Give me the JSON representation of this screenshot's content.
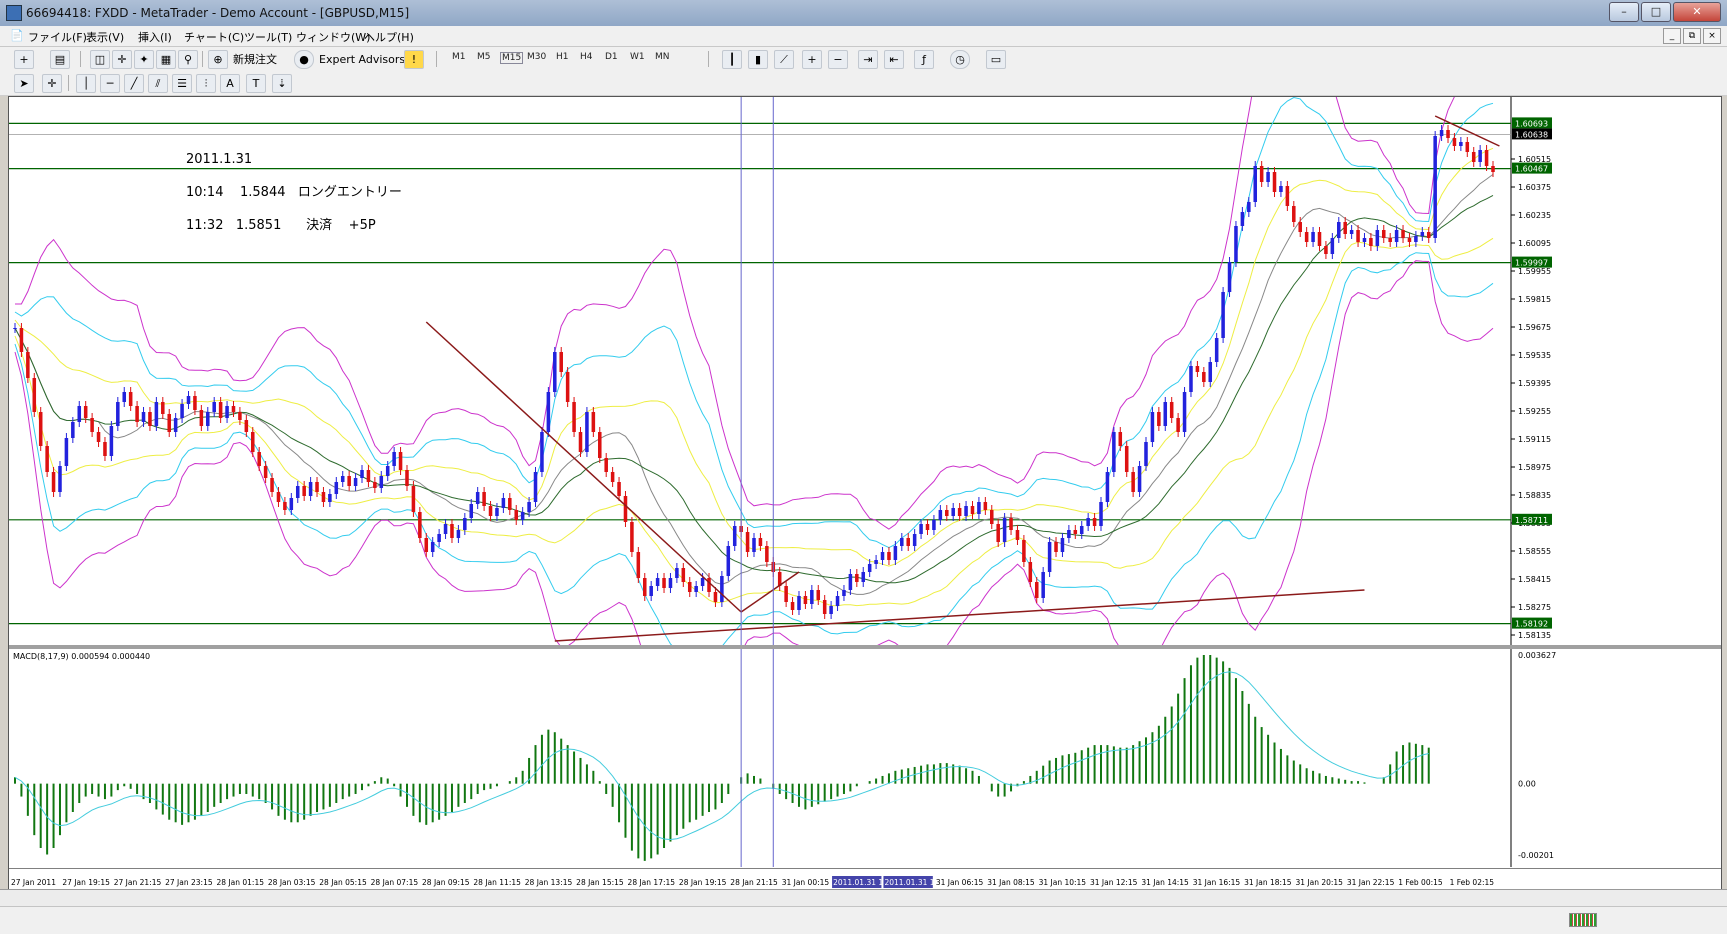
{
  "window": {
    "title": "66694418: FXDD - MetaTrader - Demo Account - [GBPUSD,M15]",
    "min_label": "–",
    "max_label": "□",
    "close_label": "✕"
  },
  "menu": [
    "ファイル(F)",
    "表示(V)",
    "挿入(I)",
    "チャート(C)",
    "ツール(T)",
    "ウィンドウ(W)",
    "ヘルプ(H)"
  ],
  "mdi_controls": [
    "_",
    "⧉",
    "×"
  ],
  "toolbar": {
    "new_order": "新規注文",
    "expert_advisors": "Expert Advisors",
    "timeframes": [
      "M1",
      "M5",
      "M15",
      "M30",
      "H1",
      "H4",
      "D1",
      "W1",
      "MN"
    ],
    "draw_text_tool": "A"
  },
  "chart": {
    "symbol": "GBPUSD",
    "period": "M15",
    "annotation": [
      "2011.1.31",
      "10:14    1.5844   ロングエントリー",
      "11:32   1.5851      決済    +5P"
    ],
    "price_axis": [
      "1.60515",
      "1.60375",
      "1.60235",
      "1.60095",
      "1.59955",
      "1.59815",
      "1.59675",
      "1.59535",
      "1.59395",
      "1.59255",
      "1.59115",
      "1.58975",
      "1.58835",
      "1.58695",
      "1.58555",
      "1.58415",
      "1.58275",
      "1.58135"
    ],
    "hlines": [
      {
        "price": 1.60693,
        "label": "1.60693"
      },
      {
        "price": 1.60467,
        "label": "1.60467"
      },
      {
        "price": 1.59997,
        "label": "1.59997"
      },
      {
        "price": 1.58711,
        "label": "1.58711"
      },
      {
        "price": 1.58192,
        "label": "1.58192"
      }
    ],
    "current_price": {
      "price": 1.60638,
      "label": "1.60638"
    },
    "price_range": [
      1.58105,
      1.60805
    ],
    "time_axis": [
      "27 Jan 2011",
      "27 Jan 19:15",
      "27 Jan 21:15",
      "27 Jan 23:15",
      "28 Jan 01:15",
      "28 Jan 03:15",
      "28 Jan 05:15",
      "28 Jan 07:15",
      "28 Jan 09:15",
      "28 Jan 11:15",
      "28 Jan 13:15",
      "28 Jan 15:15",
      "28 Jan 17:15",
      "28 Jan 19:15",
      "28 Jan 21:15",
      "31 Jan 00:15",
      "2011.01.31 10:15",
      "2011.01.31 11:30",
      "31 Jan 06:15",
      "31 Jan 08:15",
      "31 Jan 10:15",
      "31 Jan 12:15",
      "31 Jan 14:15",
      "31 Jan 16:15",
      "31 Jan 18:15",
      "31 Jan 20:15",
      "31 Jan 22:15",
      "1 Feb 00:15",
      "1 Feb 02:15"
    ],
    "vlines": [
      "2011.01.31 10:15",
      "2011.01.31 11:30"
    ]
  },
  "macd": {
    "label": "MACD(8,17,9) 0.000594 0.000440",
    "axis": [
      "0.003627",
      "0.00",
      "-0.00201"
    ],
    "range": [
      -0.00201,
      0.003627
    ]
  },
  "chart_data": {
    "type": "candlestick",
    "title": "GBPUSD,M15",
    "close": [
      1.5967,
      1.5955,
      1.5942,
      1.5925,
      1.5908,
      1.5895,
      1.5885,
      1.5898,
      1.5912,
      1.592,
      1.5928,
      1.5922,
      1.5915,
      1.591,
      1.5903,
      1.5918,
      1.593,
      1.5935,
      1.5928,
      1.592,
      1.5925,
      1.5918,
      1.593,
      1.5924,
      1.5915,
      1.5922,
      1.5929,
      1.5933,
      1.5926,
      1.5918,
      1.5925,
      1.593,
      1.5922,
      1.5928,
      1.5925,
      1.5921,
      1.5915,
      1.5905,
      1.5898,
      1.5892,
      1.5885,
      1.588,
      1.5876,
      1.5882,
      1.5888,
      1.5883,
      1.589,
      1.5885,
      1.588,
      1.5884,
      1.589,
      1.5893,
      1.5888,
      1.5892,
      1.5896,
      1.589,
      1.5887,
      1.5893,
      1.5898,
      1.5905,
      1.5896,
      1.5888,
      1.5875,
      1.5862,
      1.5855,
      1.586,
      1.5864,
      1.5869,
      1.5862,
      1.5866,
      1.5872,
      1.5879,
      1.5885,
      1.5878,
      1.5873,
      1.5877,
      1.5882,
      1.5876,
      1.5871,
      1.5875,
      1.588,
      1.5895,
      1.5915,
      1.5935,
      1.5955,
      1.5945,
      1.593,
      1.5915,
      1.5905,
      1.5925,
      1.5915,
      1.5902,
      1.5895,
      1.589,
      1.5883,
      1.587,
      1.5855,
      1.5842,
      1.5833,
      1.5838,
      1.5842,
      1.5837,
      1.5842,
      1.5847,
      1.584,
      1.5835,
      1.5838,
      1.5842,
      1.5835,
      1.583,
      1.5843,
      1.5858,
      1.5868,
      1.5865,
      1.5855,
      1.5862,
      1.5858,
      1.585,
      1.5845,
      1.5838,
      1.583,
      1.5826,
      1.5833,
      1.5829,
      1.5836,
      1.5831,
      1.5824,
      1.5828,
      1.5833,
      1.5836,
      1.5844,
      1.584,
      1.5845,
      1.5849,
      1.5851,
      1.5855,
      1.5851,
      1.5858,
      1.5862,
      1.5858,
      1.5864,
      1.5869,
      1.5866,
      1.5871,
      1.5876,
      1.5873,
      1.5877,
      1.5873,
      1.5878,
      1.5874,
      1.588,
      1.5876,
      1.5869,
      1.586,
      1.5872,
      1.5866,
      1.5861,
      1.585,
      1.584,
      1.5832,
      1.5845,
      1.586,
      1.5855,
      1.5862,
      1.5866,
      1.5864,
      1.5868,
      1.5872,
      1.5868,
      1.588,
      1.5895,
      1.5915,
      1.5908,
      1.5895,
      1.5885,
      1.5898,
      1.591,
      1.5925,
      1.5918,
      1.593,
      1.5922,
      1.5915,
      1.5935,
      1.5948,
      1.5945,
      1.594,
      1.595,
      1.5962,
      1.5985,
      1.6,
      1.6018,
      1.6025,
      1.603,
      1.6048,
      1.604,
      1.6045,
      1.6035,
      1.6038,
      1.6028,
      1.602,
      1.6015,
      1.601,
      1.6015,
      1.6008,
      1.6004,
      1.6012,
      1.602,
      1.6014,
      1.6016,
      1.601,
      1.6012,
      1.6008,
      1.6016,
      1.6012,
      1.601,
      1.6016,
      1.6012,
      1.601,
      1.6013,
      1.6015,
      1.6012,
      1.6063,
      1.6066,
      1.6062,
      1.6058,
      1.606,
      1.6055,
      1.605,
      1.6056,
      1.6048,
      1.6045
    ],
    "hist_scaled": [
      0.05,
      -0.1,
      -0.25,
      -0.4,
      -0.5,
      -0.55,
      -0.5,
      -0.4,
      -0.3,
      -0.22,
      -0.15,
      -0.1,
      -0.08,
      -0.1,
      -0.12,
      -0.1,
      -0.05,
      -0.02,
      -0.04,
      -0.08,
      -0.12,
      -0.15,
      -0.2,
      -0.24,
      -0.28,
      -0.3,
      -0.32,
      -0.3,
      -0.28,
      -0.25,
      -0.22,
      -0.18,
      -0.15,
      -0.12,
      -0.1,
      -0.08,
      -0.08,
      -0.1,
      -0.12,
      -0.15,
      -0.2,
      -0.25,
      -0.28,
      -0.3,
      -0.3,
      -0.28,
      -0.25,
      -0.22,
      -0.2,
      -0.18,
      -0.15,
      -0.12,
      -0.1,
      -0.08,
      -0.05,
      -0.02,
      0.02,
      0.05,
      0.04,
      -0.02,
      -0.1,
      -0.18,
      -0.25,
      -0.3,
      -0.32,
      -0.3,
      -0.28,
      -0.25,
      -0.22,
      -0.18,
      -0.15,
      -0.12,
      -0.08,
      -0.05,
      -0.04,
      -0.02,
      0.0,
      0.02,
      0.05,
      0.1,
      0.2,
      0.3,
      0.38,
      0.42,
      0.4,
      0.35,
      0.3,
      0.25,
      0.2,
      0.15,
      0.1,
      0.02,
      -0.08,
      -0.18,
      -0.3,
      -0.42,
      -0.52,
      -0.58,
      -0.6,
      -0.58,
      -0.55,
      -0.5,
      -0.45,
      -0.4,
      -0.35,
      -0.3,
      -0.28,
      -0.25,
      -0.22,
      -0.2,
      -0.15,
      -0.08,
      0.0,
      0.05,
      0.08,
      0.06,
      0.04,
      0.0,
      -0.04,
      -0.08,
      -0.12,
      -0.15,
      -0.18,
      -0.2,
      -0.18,
      -0.16,
      -0.14,
      -0.12,
      -0.1,
      -0.08,
      -0.06,
      -0.02,
      0.0,
      0.02,
      0.04,
      0.06,
      0.08,
      0.1,
      0.11,
      0.12,
      0.13,
      0.14,
      0.15,
      0.15,
      0.16,
      0.16,
      0.15,
      0.14,
      0.12,
      0.1,
      0.06,
      0.0,
      -0.06,
      -0.1,
      -0.1,
      -0.06,
      -0.02,
      0.02,
      0.06,
      0.1,
      0.14,
      0.18,
      0.2,
      0.22,
      0.23,
      0.24,
      0.26,
      0.28,
      0.3,
      0.3,
      0.3,
      0.29,
      0.28,
      0.28,
      0.3,
      0.33,
      0.36,
      0.4,
      0.45,
      0.52,
      0.6,
      0.7,
      0.82,
      0.92,
      0.98,
      1.0,
      1.0,
      0.98,
      0.95,
      0.9,
      0.82,
      0.72,
      0.62,
      0.52,
      0.44,
      0.38,
      0.32,
      0.27,
      0.22,
      0.18,
      0.15,
      0.12,
      0.1,
      0.08,
      0.06,
      0.05,
      0.04,
      0.03,
      0.02,
      0.02,
      0.01,
      0.0,
      0.0,
      0.05,
      0.15,
      0.25,
      0.3,
      0.32,
      0.31,
      0.3,
      0.28
    ]
  }
}
